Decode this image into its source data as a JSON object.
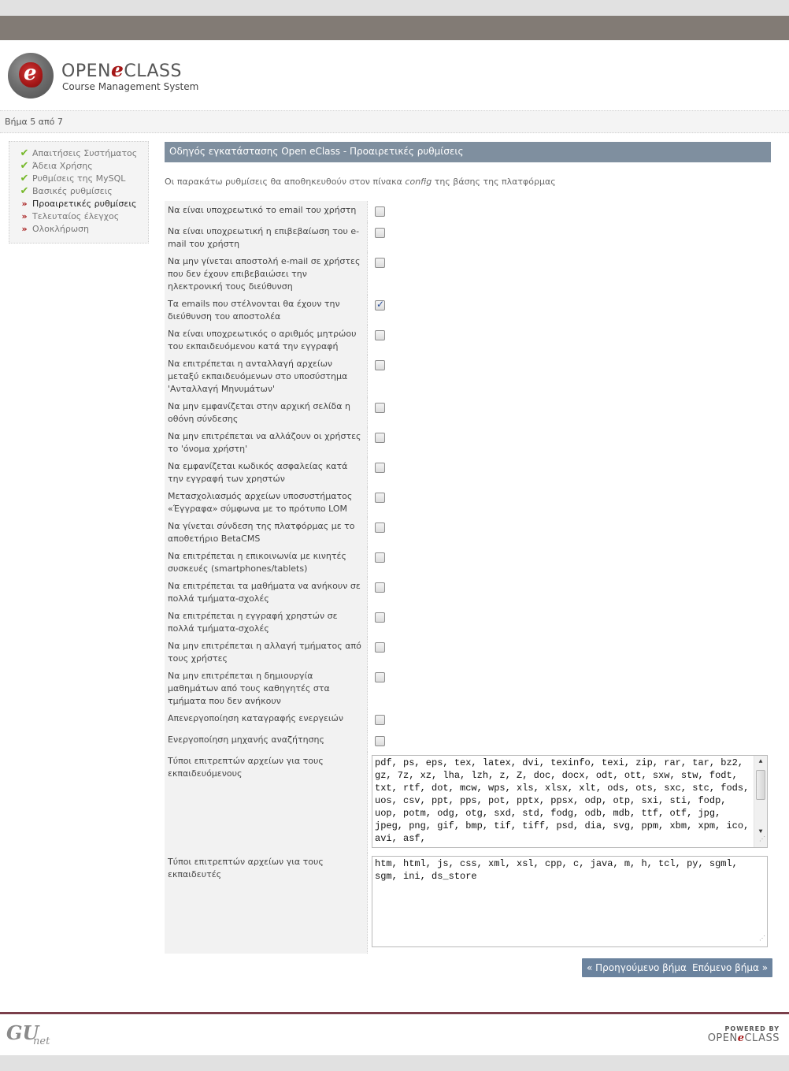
{
  "brand": {
    "name_left": "OPEN",
    "name_mid": "e",
    "name_right": "CLASS",
    "subtitle": "Course Management System"
  },
  "step_text": "Βήμα 5 από 7",
  "sidebar": {
    "items": [
      {
        "label": "Απαιτήσεις Συστήματος",
        "state": "done"
      },
      {
        "label": "Άδεια Χρήσης",
        "state": "done"
      },
      {
        "label": "Ρυθμίσεις της MySQL",
        "state": "done"
      },
      {
        "label": "Βασικές ρυθμίσεις",
        "state": "done"
      },
      {
        "label": "Προαιρετικές ρυθμίσεις",
        "state": "current"
      },
      {
        "label": "Τελευταίος έλεγχος",
        "state": "todo"
      },
      {
        "label": "Ολοκλήρωση",
        "state": "todo"
      }
    ],
    "done_icon": "check-icon",
    "todo_icon": "double-arrow-icon"
  },
  "title": "Οδηγός εγκατάστασης Open eClass - Προαιρετικές ρυθμίσεις",
  "intro": {
    "before": "Οι παρακάτω ρυθμίσεις θα αποθηκευθούν στον πίνακα ",
    "em": "config",
    "after": " της βάσης της πλατφόρμας"
  },
  "options": [
    {
      "label": "Να είναι υποχρεωτικό το email του χρήστη",
      "checked": false
    },
    {
      "label": "Να είναι υποχρεωτική η επιβεβαίωση του e-mail του χρήστη",
      "checked": false
    },
    {
      "label": "Να μην γίνεται αποστολή e-mail σε χρήστες που δεν έχουν επιβεβαιώσει την ηλεκτρονική τους διεύθυνση",
      "checked": false
    },
    {
      "label": "Τα emails που στέλνονται θα έχουν την διεύθυνση του αποστολέα",
      "checked": true
    },
    {
      "label": "Να είναι υποχρεωτικός ο αριθμός μητρώου του εκπαιδευόμενου κατά την εγγραφή",
      "checked": false
    },
    {
      "label": "Να επιτρέπεται η ανταλλαγή αρχείων μεταξύ εκπαιδευόμενων στο υποσύστημα 'Ανταλλαγή Μηνυμάτων'",
      "checked": false
    },
    {
      "label": "Να μην εμφανίζεται στην αρχική σελίδα η οθόνη σύνδεσης",
      "checked": false
    },
    {
      "label": "Να μην επιτρέπεται να αλλάζουν οι χρήστες το 'όνομα χρήστη'",
      "checked": false
    },
    {
      "label": "Να εμφανίζεται κωδικός ασφαλείας κατά την εγγραφή των χρηστών",
      "checked": false
    },
    {
      "label": "Μετασχολιασμός αρχείων υποσυστήματος «Έγγραφα» σύμφωνα με το πρότυπο LOM",
      "checked": false
    },
    {
      "label": "Να γίνεται σύνδεση της πλατφόρμας με το αποθετήριο BetaCMS",
      "checked": false
    },
    {
      "label": "Να επιτρέπεται η επικοινωνία με κινητές συσκευές (smartphones/tablets)",
      "checked": false
    },
    {
      "label": "Να επιτρέπεται τα μαθήματα να ανήκουν σε πολλά τμήματα-σχολές",
      "checked": false
    },
    {
      "label": "Να επιτρέπεται η εγγραφή χρηστών σε πολλά τμήματα-σχολές",
      "checked": false
    },
    {
      "label": "Να μην επιτρέπεται η αλλαγή τμήματος από τους χρήστες",
      "checked": false
    },
    {
      "label": "Να μην επιτρέπεται η δημιουργία μαθημάτων από τους καθηγητές στα τμήματα που δεν ανήκουν",
      "checked": false
    },
    {
      "label": "Απενεργοποίηση καταγραφής ενεργειών",
      "checked": false
    },
    {
      "label": "Ενεργοποίηση μηχανής αναζήτησης",
      "checked": false
    }
  ],
  "student_types": {
    "label": "Τύποι επιτρεπτών αρχείων για τους εκπαιδευόμενους",
    "value": "pdf, ps, eps, tex, latex, dvi, texinfo, texi, zip, rar, tar, bz2, gz, 7z, xz, lha, lzh, z, Z, doc, docx, odt, ott, sxw, stw, fodt, txt, rtf, dot, mcw, wps, xls, xlsx, xlt, ods, ots, sxc, stc, fods, uos, csv, ppt, pps, pot, pptx, ppsx, odp, otp, sxi, sti, fodp, uop, potm, odg, otg, sxd, std, fodg, odb, mdb, ttf, otf, jpg, jpeg, png, gif, bmp, tif, tiff, psd, dia, svg, ppm, xbm, xpm, ico, avi, asf,"
  },
  "teacher_types": {
    "label": "Τύποι επιτρεπτών αρχείων για τους εκπαιδευτές",
    "value": "htm, html, js, css, xml, xsl, cpp, c, java, m, h, tcl, py, sgml, sgm, ini, ds_store"
  },
  "buttons": {
    "prev": "« Προηγούμενο βήμα",
    "next": "Επόμενο βήμα »"
  },
  "footer": {
    "left_logo": "GU net",
    "powered_by": "POWERED BY"
  },
  "colors": {
    "topbar": "#827b75",
    "title_bar": "#7f8f9f",
    "button": "#6b839e",
    "brand_red": "#a51717"
  }
}
